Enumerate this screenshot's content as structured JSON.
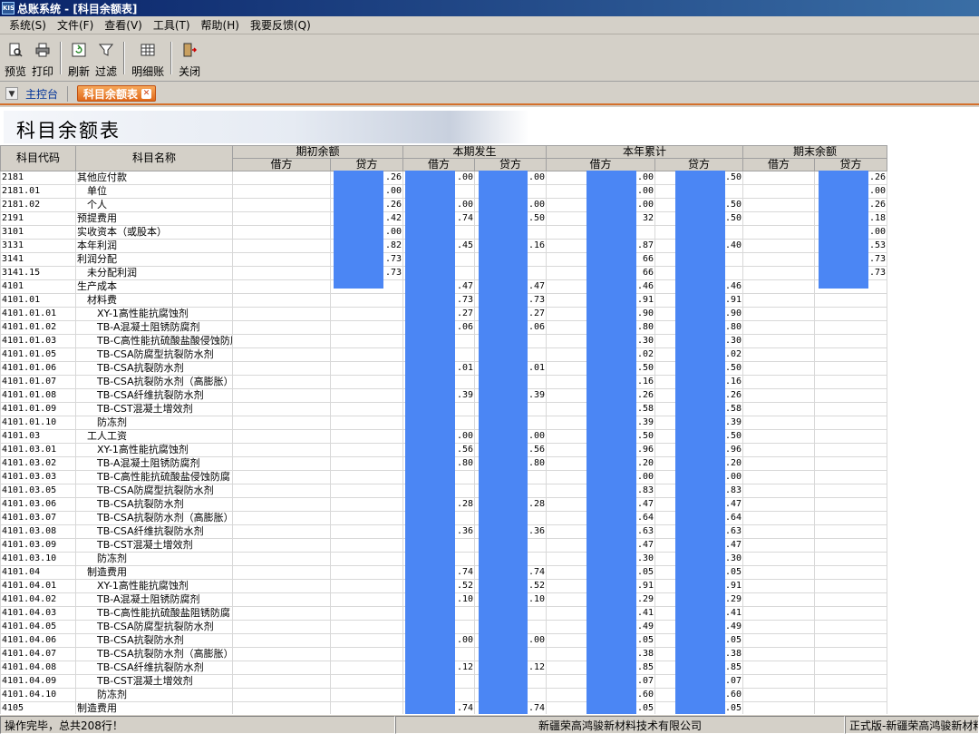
{
  "window": {
    "title": "总账系统 - [科目余额表]",
    "app_icon": "KIS"
  },
  "menu": [
    "系统(S)",
    "文件(F)",
    "查看(V)",
    "工具(T)",
    "帮助(H)",
    "我要反馈(Q)"
  ],
  "toolbar": {
    "preview": "预览",
    "print": "打印",
    "refresh": "刷新",
    "filter": "过滤",
    "detail": "明细账",
    "close": "关闭"
  },
  "tabs": {
    "home": "主控台",
    "active": "科目余额表"
  },
  "report": {
    "title": "科目余额表",
    "headers": {
      "code": "科目代码",
      "name": "科目名称",
      "opening": "期初余额",
      "period": "本期发生",
      "ytd": "本年累计",
      "closing": "期末余额",
      "debit": "借方",
      "credit": "贷方"
    },
    "rows": [
      {
        "code": "2181",
        "name": "其他应付款",
        "c2": ".26",
        "c3": ".00",
        "c4": ".00",
        "c5": ".00",
        "c6": ".50",
        "c8": ".26"
      },
      {
        "code": "2181.01",
        "name": "单位",
        "c2": ".00",
        "c5": ".00",
        "c8": ".00"
      },
      {
        "code": "2181.02",
        "name": "个人",
        "c2": ".26",
        "c3": ".00",
        "c4": ".00",
        "c5": ".00",
        "c6": ".50",
        "c8": ".26"
      },
      {
        "code": "2191",
        "name": "预提费用",
        "c2": ".42",
        "c3": ".74",
        "c4": ".50",
        "c5": "32",
        "c6": ".50",
        "c8": ".18"
      },
      {
        "code": "3101",
        "name": "实收资本（或股本）",
        "c2": ".00",
        "c8": ".00"
      },
      {
        "code": "3131",
        "name": "本年利润",
        "c2": ".82",
        "c3": ".45",
        "c4": ".16",
        "c5": ".87",
        "c6": ".40",
        "c8": ".53"
      },
      {
        "code": "3141",
        "name": "利润分配",
        "c2": ".73",
        "c5": "66",
        "c8": ".73"
      },
      {
        "code": "3141.15",
        "name": "未分配利润",
        "c2": ".73",
        "c5": "66",
        "c8": ".73"
      },
      {
        "code": "4101",
        "name": "生产成本",
        "c3": ".47",
        "c4": ".47",
        "c5": ".46",
        "c6": ".46"
      },
      {
        "code": "4101.01",
        "name": "材料费",
        "c3": ".73",
        "c4": ".73",
        "c5": ".91",
        "c6": ".91"
      },
      {
        "code": "4101.01.01",
        "name": "XY-1高性能抗腐蚀剂",
        "c3": ".27",
        "c4": ".27",
        "c5": ".90",
        "c6": ".90"
      },
      {
        "code": "4101.01.02",
        "name": "TB-A混凝土阻锈防腐剂",
        "c3": ".06",
        "c4": ".06",
        "c5": ".80",
        "c6": ".80"
      },
      {
        "code": "4101.01.03",
        "name": "TB-C高性能抗硫酸盐酸侵蚀防腐",
        "c5": ".30",
        "c6": ".30"
      },
      {
        "code": "4101.01.05",
        "name": "TB-CSA防腐型抗裂防水剂",
        "c5": ".02",
        "c6": ".02"
      },
      {
        "code": "4101.01.06",
        "name": "TB-CSA抗裂防水剂",
        "c3": ".01",
        "c4": ".01",
        "c5": ".50",
        "c6": ".50"
      },
      {
        "code": "4101.01.07",
        "name": "TB-CSA抗裂防水剂（高膨胀）",
        "c5": ".16",
        "c6": ".16"
      },
      {
        "code": "4101.01.08",
        "name": "TB-CSA纤维抗裂防水剂",
        "c3": ".39",
        "c4": ".39",
        "c5": ".26",
        "c6": ".26"
      },
      {
        "code": "4101.01.09",
        "name": "TB-CST混凝土增效剂",
        "c5": ".58",
        "c6": ".58"
      },
      {
        "code": "4101.01.10",
        "name": "防冻剂",
        "c5": ".39",
        "c6": ".39"
      },
      {
        "code": "4101.03",
        "name": "工人工资",
        "c3": ".00",
        "c4": ".00",
        "c5": ".50",
        "c6": ".50"
      },
      {
        "code": "4101.03.01",
        "name": "XY-1高性能抗腐蚀剂",
        "c3": ".56",
        "c4": ".56",
        "c5": ".96",
        "c6": ".96"
      },
      {
        "code": "4101.03.02",
        "name": "TB-A混凝土阻锈防腐剂",
        "c3": ".80",
        "c4": ".80",
        "c5": ".20",
        "c6": ".20"
      },
      {
        "code": "4101.03.03",
        "name": "TB-C高性能抗硫酸盐侵蚀防腐",
        "c5": ".00",
        "c6": ".00"
      },
      {
        "code": "4101.03.05",
        "name": "TB-CSA防腐型抗裂防水剂",
        "c5": ".83",
        "c6": ".83"
      },
      {
        "code": "4101.03.06",
        "name": "TB-CSA抗裂防水剂",
        "c3": ".28",
        "c4": ".28",
        "c5": ".47",
        "c6": ".47"
      },
      {
        "code": "4101.03.07",
        "name": "TB-CSA抗裂防水剂（高膨胀）",
        "c5": ".64",
        "c6": ".64"
      },
      {
        "code": "4101.03.08",
        "name": "TB-CSA纤维抗裂防水剂",
        "c3": ".36",
        "c4": ".36",
        "c5": ".63",
        "c6": ".63"
      },
      {
        "code": "4101.03.09",
        "name": "TB-CST混凝土增效剂",
        "c5": ".47",
        "c6": ".47"
      },
      {
        "code": "4101.03.10",
        "name": "防冻剂",
        "c5": ".30",
        "c6": ".30"
      },
      {
        "code": "4101.04",
        "name": "制造费用",
        "c3": ".74",
        "c4": ".74",
        "c5": ".05",
        "c6": ".05"
      },
      {
        "code": "4101.04.01",
        "name": "XY-1高性能抗腐蚀剂",
        "c3": ".52",
        "c4": ".52",
        "c5": ".91",
        "c6": ".91"
      },
      {
        "code": "4101.04.02",
        "name": "TB-A混凝土阻锈防腐剂",
        "c3": ".10",
        "c4": ".10",
        "c5": ".29",
        "c6": ".29"
      },
      {
        "code": "4101.04.03",
        "name": "TB-C高性能抗硫酸盐阻锈防腐",
        "c5": ".41",
        "c6": ".41"
      },
      {
        "code": "4101.04.05",
        "name": "TB-CSA防腐型抗裂防水剂",
        "c5": ".49",
        "c6": ".49"
      },
      {
        "code": "4101.04.06",
        "name": "TB-CSA抗裂防水剂",
        "c3": ".00",
        "c4": ".00",
        "c5": ".05",
        "c6": ".05"
      },
      {
        "code": "4101.04.07",
        "name": "TB-CSA抗裂防水剂（高膨胀）",
        "c5": ".38",
        "c6": ".38"
      },
      {
        "code": "4101.04.08",
        "name": "TB-CSA纤维抗裂防水剂",
        "c3": ".12",
        "c4": ".12",
        "c5": ".85",
        "c6": ".85"
      },
      {
        "code": "4101.04.09",
        "name": "TB-CST混凝土增效剂",
        "c5": ".07",
        "c6": ".07"
      },
      {
        "code": "4101.04.10",
        "name": "防冻剂",
        "c5": ".60",
        "c6": ".60"
      },
      {
        "code": "4105",
        "name": "制造费用",
        "c3": ".74",
        "c4": ".74",
        "c5": ".05",
        "c6": ".05"
      }
    ]
  },
  "status": {
    "message": "操作完毕，总共208行！",
    "company": "新疆荣高鸿骏新材料技术有限公司",
    "edition": "正式版-新疆荣高鸿骏新材料"
  },
  "colors": {
    "redaction": "#4b86f4",
    "tab_active": "#e0691a",
    "titlebar": "#0a246a"
  }
}
